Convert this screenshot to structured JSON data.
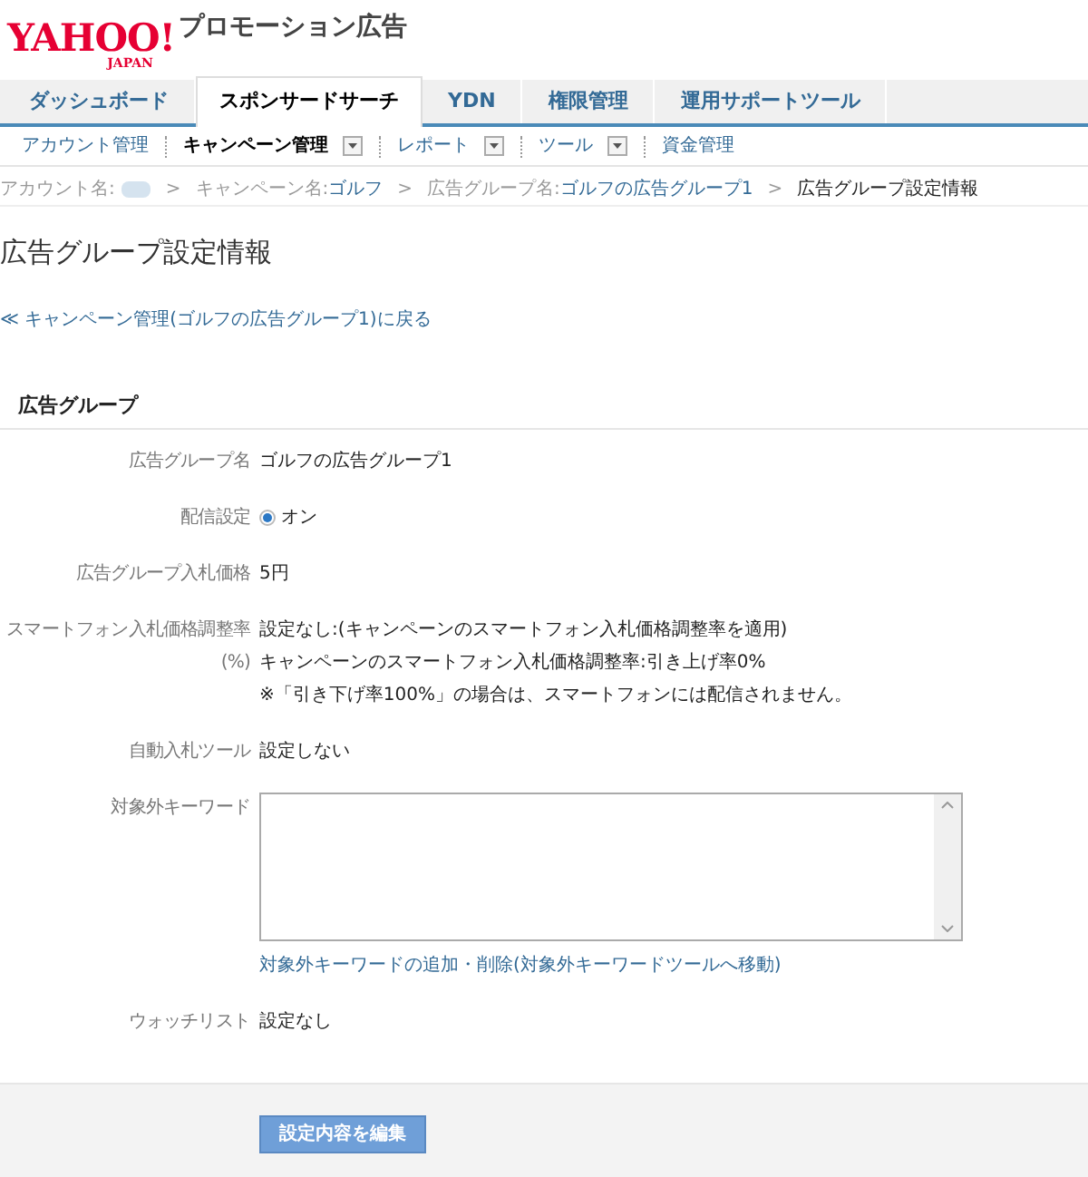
{
  "header": {
    "logo": "YAHOO!",
    "logo_sub": "JAPAN",
    "product": "プロモーション広告"
  },
  "tabs": [
    {
      "label": "ダッシュボード",
      "selected": false
    },
    {
      "label": "スポンサードサーチ",
      "selected": true
    },
    {
      "label": "YDN",
      "selected": false
    },
    {
      "label": "権限管理",
      "selected": false
    },
    {
      "label": "運用サポートツール",
      "selected": false
    }
  ],
  "subnav": [
    {
      "label": "アカウント管理",
      "selected": false,
      "dropdown": false
    },
    {
      "label": "キャンペーン管理",
      "selected": true,
      "dropdown": true
    },
    {
      "label": "レポート",
      "selected": false,
      "dropdown": true
    },
    {
      "label": "ツール",
      "selected": false,
      "dropdown": true
    },
    {
      "label": "資金管理",
      "selected": false,
      "dropdown": false
    }
  ],
  "breadcrumb": [
    {
      "label": "アカウント名:",
      "redacted": true
    },
    {
      "separator": ">",
      "label": "キャンペーン名:",
      "value": "ゴルフ"
    },
    {
      "separator": ">",
      "label": "広告グループ名:",
      "value": "ゴルフの広告グループ1"
    },
    {
      "separator": ">",
      "label": "広告グループ設定情報"
    }
  ],
  "page_title": "広告グループ設定情報",
  "back_link": "≪ キャンペーン管理(ゴルフの広告グループ1)に戻る",
  "section_title": "広告グループ",
  "fields": [
    {
      "kind": "text",
      "label": "広告グループ名",
      "value": "ゴルフの広告グループ1"
    },
    {
      "kind": "radio",
      "label": "配信設定",
      "value": "オン",
      "checked": true
    },
    {
      "kind": "text",
      "label": "広告グループ入札価格",
      "value": "5円"
    },
    {
      "kind": "multiline",
      "label": "スマートフォン入札価格調整率",
      "label_2": "(%)",
      "lines": [
        "設定なし:(キャンペーンのスマートフォン入札価格調整率を適用)",
        "キャンペーンのスマートフォン入札価格調整率:引き上げ率0%",
        "※「引き下げ率100%」の場合は、スマートフォンには配信されません。"
      ]
    },
    {
      "kind": "text",
      "label": "自動入札ツール",
      "value": "設定しない"
    },
    {
      "kind": "textarea",
      "label": "対象外キーワード",
      "link": "対象外キーワードの追加・削除(対象外キーワードツールへ移動)"
    },
    {
      "kind": "text",
      "label": "ウォッチリスト",
      "value": "設定なし"
    }
  ],
  "edit_button": "設定内容を編集"
}
